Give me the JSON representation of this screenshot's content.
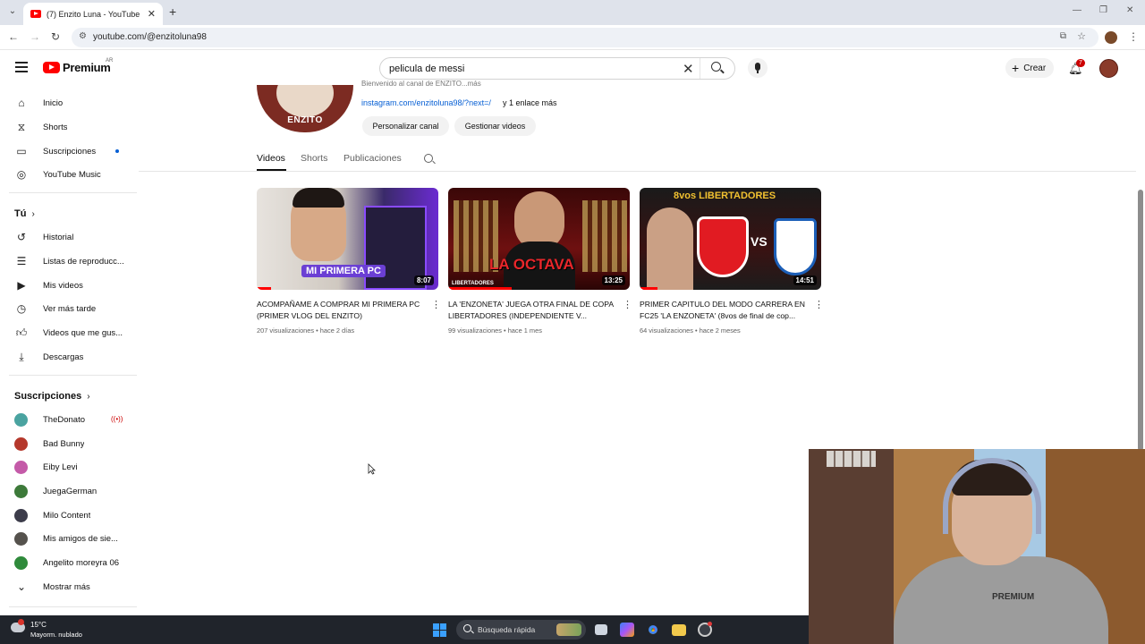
{
  "browser": {
    "tab_title": "(7) Enzito Luna - YouTube",
    "url": "youtube.com/@enzitoluna98",
    "tab_close": "✕",
    "new_tab": "+"
  },
  "header": {
    "logo_text": "Premium",
    "country_code": "AR",
    "search_value": "pelicula de messi",
    "create_label": "Crear",
    "notification_count": "7"
  },
  "sidebar": {
    "main": [
      {
        "label": "Inicio",
        "icon": "home-icon"
      },
      {
        "label": "Shorts",
        "icon": "shorts-icon"
      },
      {
        "label": "Suscripciones",
        "icon": "subscriptions-icon"
      },
      {
        "label": "YouTube Music",
        "icon": "music-icon"
      }
    ],
    "you_title": "Tú",
    "you": [
      {
        "label": "Historial",
        "icon": "history-icon"
      },
      {
        "label": "Listas de reproducc...",
        "icon": "playlists-icon"
      },
      {
        "label": "Mis videos",
        "icon": "my-videos-icon"
      },
      {
        "label": "Ver más tarde",
        "icon": "watch-later-icon"
      },
      {
        "label": "Videos que me gus...",
        "icon": "liked-icon"
      },
      {
        "label": "Descargas",
        "icon": "downloads-icon"
      }
    ],
    "subs_title": "Suscripciones",
    "subs": [
      {
        "label": "TheDonato",
        "color": "#4aa3a0"
      },
      {
        "label": "Bad Bunny",
        "color": "#b5382c"
      },
      {
        "label": "Eiby Levi",
        "color": "#c45aa8"
      },
      {
        "label": "JuegaGerman",
        "color": "#3d7a3a"
      },
      {
        "label": "Milo Content",
        "color": "#3c3c4a"
      },
      {
        "label": "Mis amigos de sie...",
        "color": "#55524d"
      },
      {
        "label": "Angelito moreyra 06",
        "color": "#2f8a3b"
      }
    ],
    "show_more": "Mostrar más"
  },
  "channel": {
    "avatar_text": "ENZITO",
    "desc_faded": "Bienvenido al canal de ENZITO...más",
    "link": "instagram.com/enzitoluna98/?next=/",
    "more_links": "y 1 enlace más",
    "customize_button": "Personalizar canal",
    "manage_button": "Gestionar videos",
    "tabs": [
      "Videos",
      "Shorts",
      "Publicaciones"
    ]
  },
  "videos": [
    {
      "title": "ACOMPAÑAME A COMPRAR MI PRIMERA PC (PRIMER VLOG DEL ENZITO)",
      "views": "207 visualizaciones",
      "age": "hace 2 días",
      "duration": "8:07",
      "thumb_text": "MI PRIMERA PC",
      "watched": 0.08
    },
    {
      "title": "LA 'ENZONETA' JUEGA OTRA FINAL DE COPA LIBERTADORES (INDEPENDIENTE V...",
      "views": "99 visualizaciones",
      "age": "hace 1 mes",
      "duration": "13:25",
      "thumb_text": "LA OCTAVA",
      "thumb_sub": "LIBERTADORES",
      "watched": 0.35
    },
    {
      "title": "PRIMER CAPITULO DEL MODO CARRERA EN FC25 'LA ENZONETA' (8vos de final de cop...",
      "views": "64 visualizaciones",
      "age": "hace 2 meses",
      "duration": "14:51",
      "thumb_text": "8vos LIBERTADORES",
      "thumb_vs": "VS",
      "watched": 0.1
    }
  ],
  "meta_sep": " • ",
  "webcam": {
    "shirt_text": "PREMIUM"
  },
  "taskbar": {
    "temp": "15°C",
    "condition": "Mayorm. nublado",
    "search_placeholder": "Búsqueda rápida"
  }
}
